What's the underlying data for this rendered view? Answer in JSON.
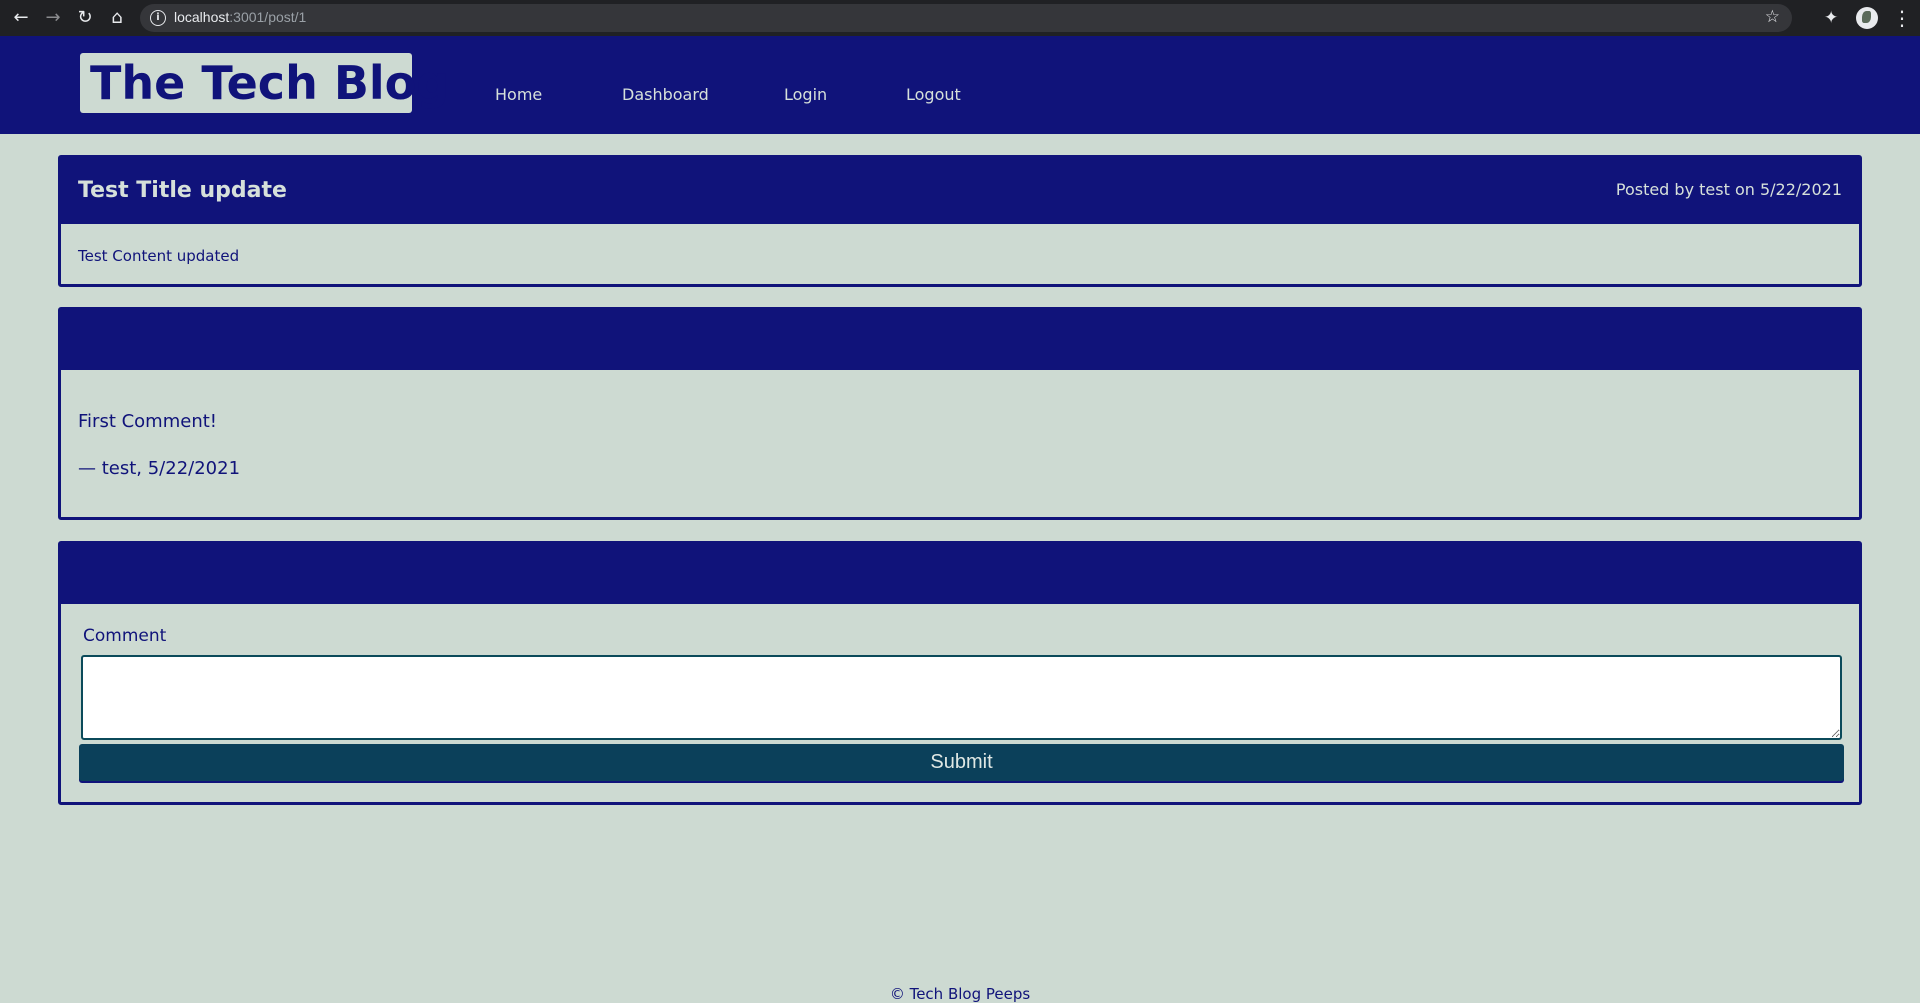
{
  "browser": {
    "url_host": "localhost",
    "url_path": ":3001/post/1",
    "back_icon": "←",
    "forward_icon": "→",
    "reload_icon": "↻",
    "home_icon": "⌂",
    "star_icon": "☆",
    "extensions_icon": "✦",
    "menu_icon": "⋮"
  },
  "header": {
    "logo": "The Tech Blog",
    "nav": {
      "home": "Home",
      "dashboard": "Dashboard",
      "login": "Login",
      "logout": "Logout"
    }
  },
  "post": {
    "title": "Test Title update",
    "meta": "Posted by test on 5/22/2021",
    "content": "Test Content updated"
  },
  "comments": [
    {
      "text": "First Comment!",
      "meta": "— test, 5/22/2021"
    }
  ],
  "comment_form": {
    "label": "Comment",
    "value": "",
    "submit_label": "Submit"
  },
  "footer": {
    "text": "© Tech Blog Peeps"
  },
  "colors": {
    "primary": "#10137a",
    "background": "#cddad2",
    "button": "#0b405a"
  }
}
